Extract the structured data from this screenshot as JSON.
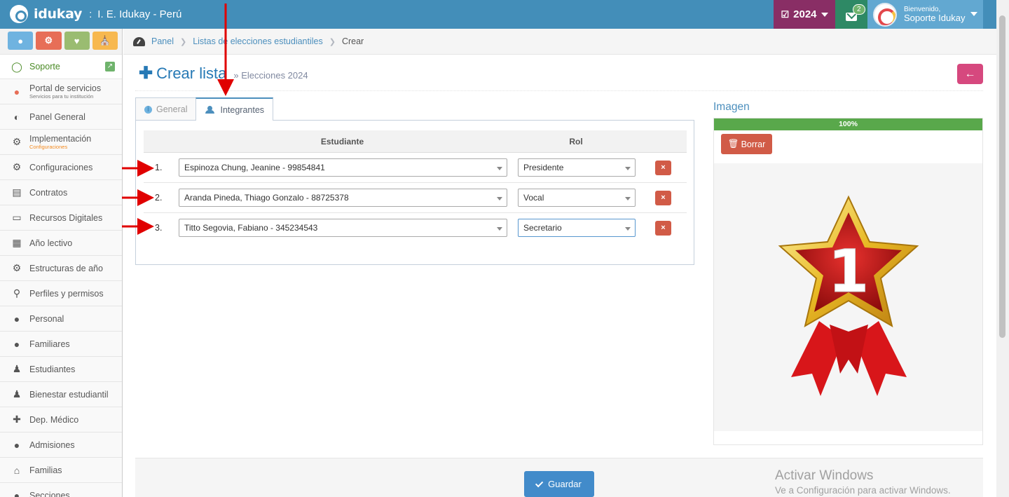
{
  "topbar": {
    "brand": "idukay",
    "separator": ":",
    "school": "I. E. Idukay - Perú",
    "year": "2024",
    "messages_count": "2",
    "user_welcome": "Bienvenido,",
    "user_name": "Soporte Idukay"
  },
  "sidebar": {
    "soporte": "Soporte",
    "portal": {
      "label": "Portal de servicios",
      "sub": "Servicios para tu institución"
    },
    "items": [
      {
        "label": "Panel General",
        "icon": "dashboard-icon"
      },
      {
        "label": "Implementación",
        "sub": "Configuraciones",
        "icon": "cogs-icon"
      },
      {
        "label": "Configuraciones",
        "icon": "cogs-icon"
      },
      {
        "label": "Contratos",
        "icon": "document-icon"
      },
      {
        "label": "Recursos Digitales",
        "icon": "laptop-icon"
      },
      {
        "label": "Año lectivo",
        "icon": "calendar-icon"
      },
      {
        "label": "Estructuras de año",
        "icon": "gear-icon"
      },
      {
        "label": "Perfiles y permisos",
        "icon": "key-icon"
      },
      {
        "label": "Personal",
        "icon": "user-icon"
      },
      {
        "label": "Familiares",
        "icon": "user-icon"
      },
      {
        "label": "Estudiantes",
        "icon": "male-icon"
      },
      {
        "label": "Bienestar estudiantil",
        "icon": "wellbeing-icon"
      },
      {
        "label": "Dep. Médico",
        "icon": "medkit-icon"
      },
      {
        "label": "Admisiones",
        "icon": "group-icon"
      },
      {
        "label": "Familias",
        "icon": "home-icon"
      },
      {
        "label": "Secciones",
        "icon": "user-icon"
      }
    ]
  },
  "breadcrumb": {
    "panel": "Panel",
    "list": "Listas de elecciones estudiantiles",
    "current": "Crear"
  },
  "header": {
    "title": "Crear lista",
    "subtitle": "» Elecciones 2024"
  },
  "tabs": {
    "general": "General",
    "members": "Integrantes"
  },
  "table": {
    "headers": {
      "student": "Estudiante",
      "role": "Rol"
    },
    "rows": [
      {
        "num": "1.",
        "student": "Espinoza Chung, Jeanine - 99854841",
        "role": "Presidente"
      },
      {
        "num": "2.",
        "student": "Aranda Pineda, Thiago Gonzalo - 88725378",
        "role": "Vocal"
      },
      {
        "num": "3.",
        "student": "Titto Segovia, Fabiano - 345234543",
        "role": "Secretario"
      }
    ],
    "delete_glyph": "×"
  },
  "image": {
    "title": "Imagen",
    "progress": "100%",
    "progress_value": 1.0,
    "delete_label": "Borrar",
    "badge_number": "1"
  },
  "actions": {
    "save": "Guardar"
  },
  "watermark": {
    "title": "Activar Windows",
    "subtitle": "Ve a Configuración para activar Windows."
  },
  "colors": {
    "topbar": "#438eb9",
    "year_bg": "#892e65",
    "messages_bg": "#2e8965",
    "user_bg": "#62a8d1",
    "accent": "#2679b5",
    "danger": "#d15b47",
    "success": "#59a84b",
    "annotation": "#e00000"
  }
}
